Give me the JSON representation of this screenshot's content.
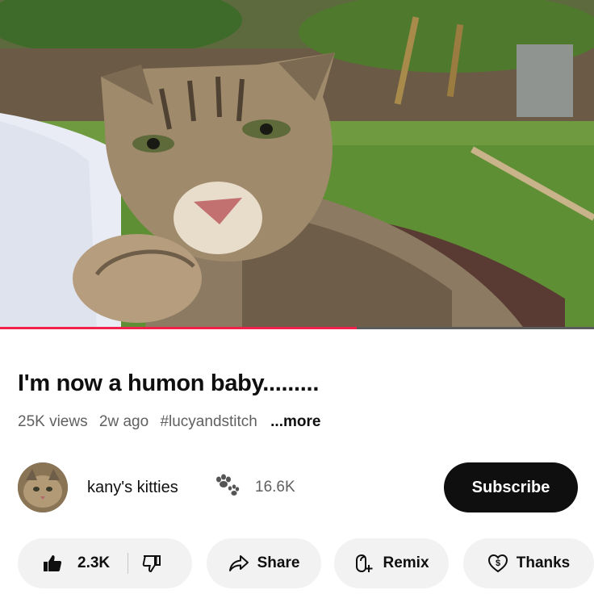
{
  "video": {
    "progress_fraction": 0.6,
    "icons": {
      "progress": "progress-bar"
    }
  },
  "info": {
    "title": "I'm now a humon baby.........",
    "views": "25K views",
    "age": "2w ago",
    "hashtag": "#lucyandstitch",
    "more_label": "...more"
  },
  "channel": {
    "name": "kany's kitties",
    "badge_icon": "paw-icon",
    "subscribers": "16.6K",
    "subscribe_label": "Subscribe"
  },
  "actions": {
    "likes": "2.3K",
    "like_icon": "thumbs-up-icon",
    "dislike_icon": "thumbs-down-icon",
    "share_label": "Share",
    "share_icon": "share-arrow-icon",
    "remix_label": "Remix",
    "remix_icon": "remix-icon",
    "thanks_label": "Thanks",
    "thanks_icon": "thanks-heart-dollar-icon"
  },
  "colors": {
    "progress_red": "#f0224b",
    "subscribe_bg": "#0f0f0f",
    "pill_bg": "#f2f2f2",
    "meta_gray": "#606060"
  }
}
